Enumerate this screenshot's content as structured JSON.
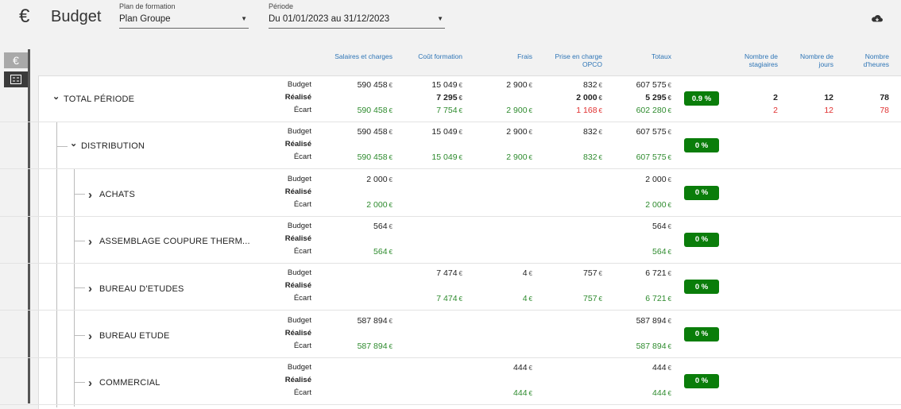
{
  "header": {
    "title": "Budget",
    "plan_label": "Plan de formation",
    "plan_value": "Plan Groupe",
    "period_label": "Période",
    "period_value": "Du 01/01/2023 au 31/12/2023"
  },
  "icons": {
    "app": "euro-icon",
    "download": "cloud-download-icon",
    "tab1": "euro-icon",
    "tab2": "list-check-icon"
  },
  "columns": [
    "Salaires et charges",
    "Coût formation",
    "Frais",
    "Prise en charge OPCO",
    "Totaux",
    "Nombre de stagiaires",
    "Nombre de jours",
    "Nombre d'heures"
  ],
  "sub_labels": [
    "Budget",
    "Réalisé",
    "Écart"
  ],
  "unit": "€",
  "rows": [
    {
      "label": "TOTAL PÉRIODE",
      "expanded": true,
      "level": 0,
      "pct": "0.9 %",
      "budget": [
        "590 458",
        "15 049",
        "2 900",
        "832",
        "607 575"
      ],
      "realise": [
        "",
        "7 295",
        "",
        "2 000",
        "5 295"
      ],
      "ecart": [
        "590 458",
        "7 754",
        "2 900",
        "1 168",
        "602 280"
      ],
      "counts_realise": [
        "2",
        "12",
        "78"
      ],
      "counts_ecart": [
        "2",
        "12",
        "78"
      ]
    },
    {
      "label": "DISTRIBUTION",
      "expanded": true,
      "level": 1,
      "pct": "0 %",
      "budget": [
        "590 458",
        "15 049",
        "2 900",
        "832",
        "607 575"
      ],
      "realise": [
        "",
        "",
        "",
        "",
        ""
      ],
      "ecart": [
        "590 458",
        "15 049",
        "2 900",
        "832",
        "607 575"
      ]
    },
    {
      "label": "ACHATS",
      "expanded": false,
      "level": 2,
      "pct": "0 %",
      "budget": [
        "2 000",
        "",
        "",
        "",
        "2 000"
      ],
      "realise": [
        "",
        "",
        "",
        "",
        ""
      ],
      "ecart": [
        "2 000",
        "",
        "",
        "",
        "2 000"
      ]
    },
    {
      "label": "ASSEMBLAGE COUPURE THERM...",
      "expanded": false,
      "level": 2,
      "pct": "0 %",
      "budget": [
        "564",
        "",
        "",
        "",
        "564"
      ],
      "realise": [
        "",
        "",
        "",
        "",
        ""
      ],
      "ecart": [
        "564",
        "",
        "",
        "",
        "564"
      ]
    },
    {
      "label": "BUREAU D'ETUDES",
      "expanded": false,
      "level": 2,
      "pct": "0 %",
      "budget": [
        "",
        "7 474",
        "4",
        "757",
        "6 721"
      ],
      "realise": [
        "",
        "",
        "",
        "",
        ""
      ],
      "ecart": [
        "",
        "7 474",
        "4",
        "757",
        "6 721"
      ]
    },
    {
      "label": "BUREAU ETUDE",
      "expanded": false,
      "level": 2,
      "pct": "0 %",
      "budget": [
        "587 894",
        "",
        "",
        "",
        "587 894"
      ],
      "realise": [
        "",
        "",
        "",
        "",
        ""
      ],
      "ecart": [
        "587 894",
        "",
        "",
        "",
        "587 894"
      ]
    },
    {
      "label": "COMMERCIAL",
      "expanded": false,
      "level": 2,
      "pct": "0 %",
      "budget": [
        "",
        "",
        "444",
        "",
        "444"
      ],
      "realise": [
        "",
        "",
        "",
        "",
        ""
      ],
      "ecart": [
        "",
        "",
        "444",
        "",
        "444"
      ]
    }
  ]
}
